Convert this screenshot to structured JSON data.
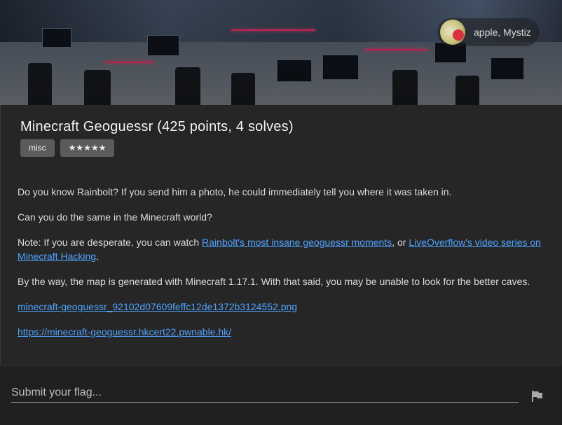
{
  "header": {
    "authors": "apple, Mystiz"
  },
  "challenge": {
    "title": "Minecraft Geoguessr (425 points, 4 solves)",
    "tags": [
      "misc",
      "★★★★★"
    ]
  },
  "description": {
    "p1": "Do you know Rainbolt? If you send him a photo, he could immediately tell you where it was taken in.",
    "p2": "Can you do the same in the Minecraft world?",
    "p3_prefix": "Note: If you are desperate, you can watch ",
    "p3_link1": "Rainbolt's most insane geoguessr moments",
    "p3_middle": ", or ",
    "p3_link2": "LiveOverflow's video series on Minecraft Hacking",
    "p3_suffix": ".",
    "p4": "By the way, the map is generated with Minecraft 1.17.1. With that said, you may be unable to look for the better caves.",
    "attachment": "minecraft-geoguessr_92102d07609feffc12de1372b3124552.png",
    "url": "https://minecraft-geoguessr.hkcert22.pwnable.hk/"
  },
  "flag": {
    "placeholder": "Submit your flag..."
  },
  "colors": {
    "link": "#4ea3ff",
    "chip": "#5b5b5b",
    "card": "#262626"
  }
}
